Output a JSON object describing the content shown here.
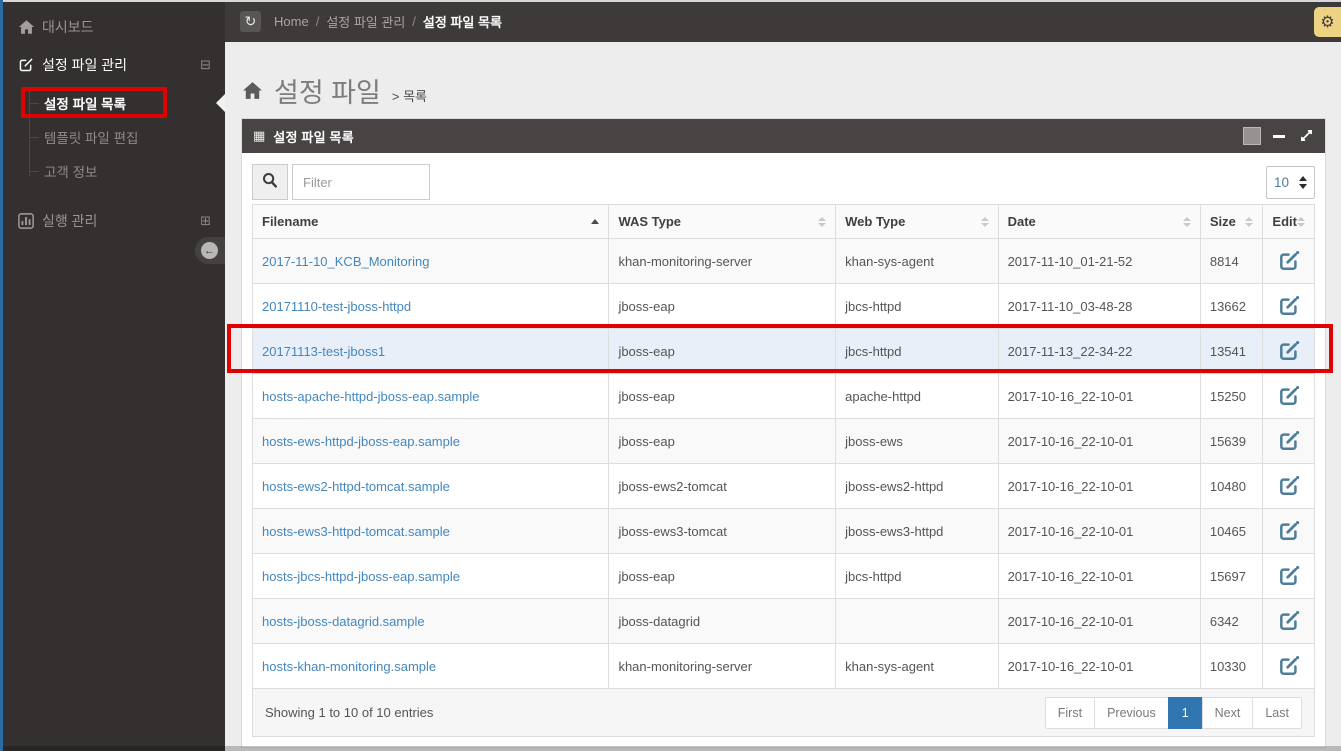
{
  "topbar": {
    "breadcrumb": [
      "Home",
      "설정 파일 관리",
      "설정 파일 목록"
    ],
    "separator": "/",
    "refresh_icon": "↻",
    "gear_icon": "⚙"
  },
  "sidebar": {
    "items": [
      {
        "label": "대시보드",
        "icon": "home"
      },
      {
        "label": "설정 파일 관리",
        "icon": "edit-square",
        "toggle_icon": "⊟",
        "expanded": true,
        "children": [
          "설정 파일 목록",
          "템플릿 파일 편집",
          "고객 정보"
        ]
      },
      {
        "label": "실행 관리",
        "icon": "bar-chart",
        "toggle_icon": "⊞",
        "expanded": false
      }
    ],
    "active_child": "설정 파일 목록",
    "collapse_arrow": "←"
  },
  "page": {
    "title": "설정 파일",
    "subtitle_sep": ">",
    "subtitle": "목록"
  },
  "panel": {
    "title": "설정 파일 목록",
    "grid_icon": "▦",
    "filter_placeholder": "Filter",
    "page_size": "10"
  },
  "table": {
    "columns": [
      "Filename",
      "WAS Type",
      "Web Type",
      "Date",
      "Size",
      "Edit"
    ],
    "sorted_column": "Filename",
    "sort_direction": "asc",
    "rows": [
      {
        "filename": "2017-11-10_KCB_Monitoring",
        "was_type": "khan-monitoring-server",
        "web_type": "khan-sys-agent",
        "date": "2017-11-10_01-21-52",
        "size": "8814",
        "selected": false
      },
      {
        "filename": "20171110-test-jboss-httpd",
        "was_type": "jboss-eap",
        "web_type": "jbcs-httpd",
        "date": "2017-11-10_03-48-28",
        "size": "13662",
        "selected": false
      },
      {
        "filename": "20171113-test-jboss1",
        "was_type": "jboss-eap",
        "web_type": "jbcs-httpd",
        "date": "2017-11-13_22-34-22",
        "size": "13541",
        "selected": true
      },
      {
        "filename": "hosts-apache-httpd-jboss-eap.sample",
        "was_type": "jboss-eap",
        "web_type": "apache-httpd",
        "date": "2017-10-16_22-10-01",
        "size": "15250",
        "selected": false
      },
      {
        "filename": "hosts-ews-httpd-jboss-eap.sample",
        "was_type": "jboss-eap",
        "web_type": "jboss-ews",
        "date": "2017-10-16_22-10-01",
        "size": "15639",
        "selected": false
      },
      {
        "filename": "hosts-ews2-httpd-tomcat.sample",
        "was_type": "jboss-ews2-tomcat",
        "web_type": "jboss-ews2-httpd",
        "date": "2017-10-16_22-10-01",
        "size": "10480",
        "selected": false
      },
      {
        "filename": "hosts-ews3-httpd-tomcat.sample",
        "was_type": "jboss-ews3-tomcat",
        "web_type": "jboss-ews3-httpd",
        "date": "2017-10-16_22-10-01",
        "size": "10465",
        "selected": false
      },
      {
        "filename": "hosts-jbcs-httpd-jboss-eap.sample",
        "was_type": "jboss-eap",
        "web_type": "jbcs-httpd",
        "date": "2017-10-16_22-10-01",
        "size": "15697",
        "selected": false
      },
      {
        "filename": "hosts-jboss-datagrid.sample",
        "was_type": "jboss-datagrid",
        "web_type": "",
        "date": "2017-10-16_22-10-01",
        "size": "6342",
        "selected": false
      },
      {
        "filename": "hosts-khan-monitoring.sample",
        "was_type": "khan-monitoring-server",
        "web_type": "khan-sys-agent",
        "date": "2017-10-16_22-10-01",
        "size": "10330",
        "selected": false
      }
    ]
  },
  "footer": {
    "summary": "Showing 1 to 10 of 10 entries",
    "pagination": [
      "First",
      "Previous",
      "1",
      "Next",
      "Last"
    ],
    "active_page": "1"
  },
  "colors": {
    "frame_accent": "#2d6ba3",
    "topbar_bg": "#3e3a3a",
    "sidebar_bg": "#343030",
    "panel_header_bg": "#494444",
    "link": "#4387c0",
    "selected_row_bg": "#e8eff8",
    "annotation_red": "#de0202",
    "gear_button_bg": "#eed283",
    "edit_icon": "#4c7e9c",
    "pagination_active": "#3276b1"
  }
}
